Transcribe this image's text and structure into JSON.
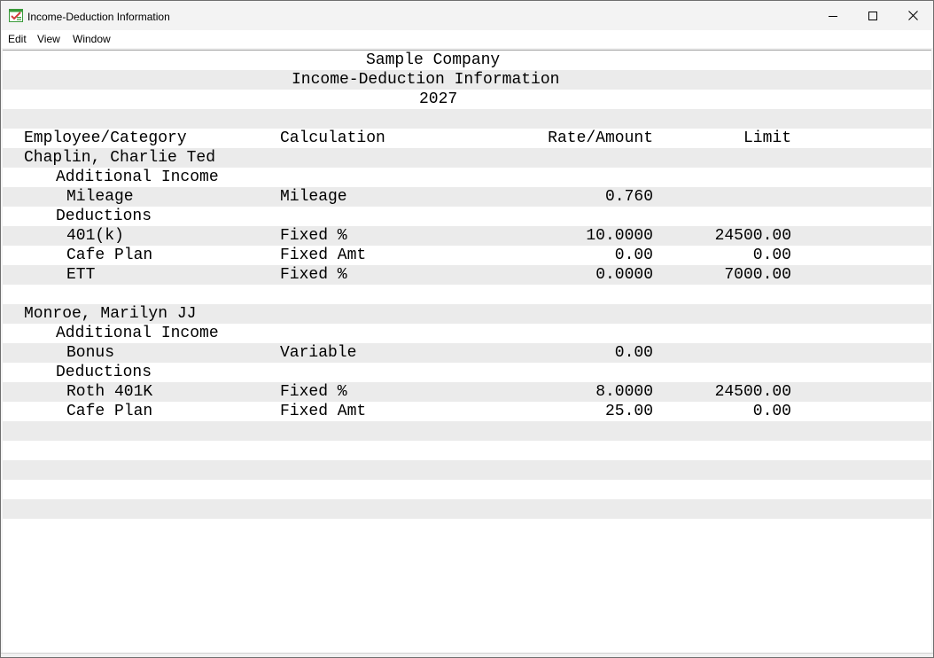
{
  "window": {
    "title": "Income-Deduction Information",
    "minimize_icon": "minimize-icon",
    "maximize_icon": "maximize-icon",
    "close_icon": "close-icon"
  },
  "menu": {
    "edit": "Edit",
    "view": "View",
    "window": "Window"
  },
  "report": {
    "company": "Sample Company",
    "title": "Income-Deduction Information",
    "year": "2027",
    "columns": {
      "employee_category": "Employee/Category",
      "calculation": "Calculation",
      "rate_amount": "Rate/Amount",
      "limit": "Limit"
    },
    "employees": [
      {
        "name": "Chaplin, Charlie Ted",
        "additional_income_label": "Additional Income",
        "additional_income": [
          {
            "item": "Mileage",
            "calculation": "Mileage",
            "rate": "0.760",
            "limit": ""
          }
        ],
        "deductions_label": "Deductions",
        "deductions": [
          {
            "item": "401(k)",
            "calculation": "Fixed %",
            "rate": "10.0000",
            "limit": "24500.00"
          },
          {
            "item": "Cafe Plan",
            "calculation": "Fixed Amt",
            "rate": "0.00",
            "limit": "0.00"
          },
          {
            "item": "ETT",
            "calculation": "Fixed %",
            "rate": "0.0000",
            "limit": "7000.00"
          }
        ]
      },
      {
        "name": "Monroe, Marilyn JJ",
        "additional_income_label": "Additional Income",
        "additional_income": [
          {
            "item": "Bonus",
            "calculation": "Variable",
            "rate": "0.00",
            "limit": ""
          }
        ],
        "deductions_label": "Deductions",
        "deductions": [
          {
            "item": "Roth 401K",
            "calculation": "Fixed %",
            "rate": "8.0000",
            "limit": "24500.00"
          },
          {
            "item": "Cafe Plan",
            "calculation": "Fixed Amt",
            "rate": "25.00",
            "limit": "0.00"
          }
        ]
      }
    ]
  },
  "colors": {
    "row_shade": "#ebebeb",
    "titlebar": "#f3f3f3",
    "icon_green": "#3a9a3a",
    "icon_red": "#d23c3c"
  }
}
